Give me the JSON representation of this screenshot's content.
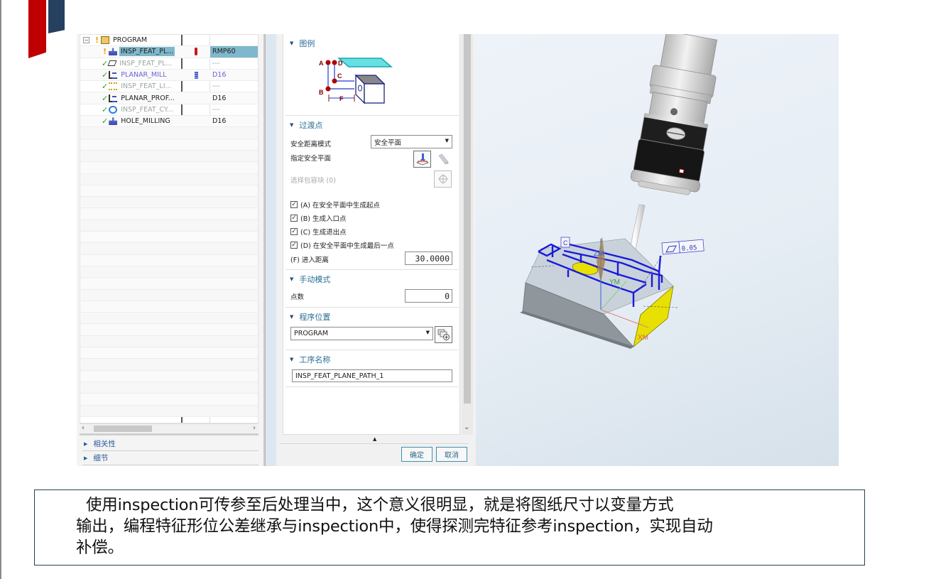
{
  "navigator": {
    "tree": [
      {
        "name": "PROGRAM",
        "flag": "",
        "tool": "",
        "status": "",
        "type": "program-group",
        "style": "normal",
        "expander": "−"
      },
      {
        "name": "INSP_FEAT_PL...",
        "flag": "thermometer",
        "tool": "RMP60",
        "status": "warning",
        "type": "probe-op",
        "style": "normal",
        "selected": true
      },
      {
        "name": "INSP_FEAT_PL...",
        "flag": "",
        "tool": "---",
        "status": "complete",
        "type": "plane-op",
        "style": "muted"
      },
      {
        "name": "PLANAR_MILL",
        "flag": "tool",
        "tool": "D16",
        "status": "complete",
        "type": "mill-op",
        "style": "purple"
      },
      {
        "name": "INSP_FEAT_LI...",
        "flag": "",
        "tool": "---",
        "status": "complete",
        "type": "line-op",
        "style": "muted"
      },
      {
        "name": "PLANAR_PROF...",
        "flag": "",
        "tool": "D16",
        "status": "complete",
        "type": "mill-op",
        "style": "normal"
      },
      {
        "name": "INSP_FEAT_CY...",
        "flag": "",
        "tool": "---",
        "status": "complete",
        "type": "cylinder-op",
        "style": "muted"
      },
      {
        "name": "HOLE_MILLING",
        "flag": "",
        "tool": "D16",
        "status": "complete",
        "type": "probe-op",
        "style": "normal"
      }
    ],
    "panels": [
      {
        "label": "相关性"
      },
      {
        "label": "细节"
      }
    ]
  },
  "dialog": {
    "sections": {
      "legend": {
        "title": "图例",
        "diagram_labels": {
          "a": "A",
          "b": "B",
          "c": "C",
          "d": "D",
          "f": "F"
        }
      },
      "transfer": {
        "title": "过渡点",
        "safe_mode_label": "安全距离模式",
        "safe_mode_value": "安全平面",
        "specify_plane_label": "指定安全平面",
        "select_box_label": "选择包容块 (0)",
        "checkboxes": [
          {
            "label": "(A) 在安全平面中生成起点",
            "checked": true
          },
          {
            "label": "(B) 生成入口点",
            "checked": true
          },
          {
            "label": "(C) 生成退出点",
            "checked": true
          },
          {
            "label": "(D) 在安全平面中生成最后一点",
            "checked": true
          }
        ],
        "approach_label": "(F) 进入距离",
        "approach_value": "30.0000"
      },
      "manual": {
        "title": "手动模式",
        "points_label": "点数",
        "points_value": "0"
      },
      "program": {
        "title": "程序位置",
        "value": "PROGRAM"
      },
      "operation": {
        "title": "工序名称",
        "value": "INSP_FEAT_PLANE_PATH_1"
      }
    },
    "ok_label": "确定",
    "cancel_label": "取消"
  },
  "viewport": {
    "datum_label": "C",
    "tolerance_value": "0.05",
    "axis_labels": {
      "z": "ZM",
      "y": "YM",
      "x": "XM"
    }
  },
  "caption": {
    "line1": "使用inspection可传参至后处理当中，这个意义很明显，就是将图纸尺寸以变量方式",
    "line2": "输出，编程特征形位公差继承与inspection中，使得探测完特征参考inspection，实现自动",
    "line3": "补偿。"
  },
  "colors": {
    "brand_red": "#c00000",
    "brand_navy": "#26405f",
    "selection": "#7fb7cc",
    "section_title": "#2a6f97",
    "path_blue": "#1a1adc",
    "face_yellow": "#e8e000"
  }
}
